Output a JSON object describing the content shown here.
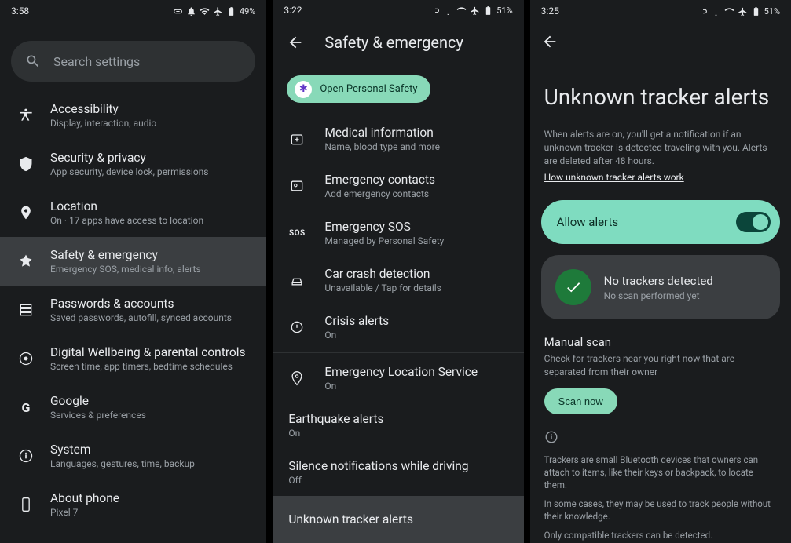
{
  "screen1": {
    "time": "3:58",
    "battery": "49%",
    "search_placeholder": "Search settings",
    "items": [
      {
        "title": "Accessibility",
        "sub": "Display, interaction, audio"
      },
      {
        "title": "Security & privacy",
        "sub": "App security, device lock, permissions"
      },
      {
        "title": "Location",
        "sub": "On · 17 apps have access to location"
      },
      {
        "title": "Safety & emergency",
        "sub": "Emergency SOS, medical info, alerts"
      },
      {
        "title": "Passwords & accounts",
        "sub": "Saved passwords, autofill, synced accounts"
      },
      {
        "title": "Digital Wellbeing & parental controls",
        "sub": "Screen time, app timers, bedtime schedules"
      },
      {
        "title": "Google",
        "sub": "Services & preferences"
      },
      {
        "title": "System",
        "sub": "Languages, gestures, time, backup"
      },
      {
        "title": "About phone",
        "sub": "Pixel 7"
      }
    ]
  },
  "screen2": {
    "time": "3:22",
    "battery": "51%",
    "title": "Safety & emergency",
    "chip": "Open Personal Safety",
    "items": [
      {
        "title": "Medical information",
        "sub": "Name, blood type and more"
      },
      {
        "title": "Emergency contacts",
        "sub": "Add emergency contacts"
      },
      {
        "title": "Emergency SOS",
        "sub": "Managed by Personal Safety"
      },
      {
        "title": "Car crash detection",
        "sub": "Unavailable / Tap for details"
      },
      {
        "title": "Crisis alerts",
        "sub": "On"
      },
      {
        "title": "Emergency Location Service",
        "sub": "On"
      },
      {
        "title": "Earthquake alerts",
        "sub": "On"
      },
      {
        "title": "Silence notifications while driving",
        "sub": "Off"
      },
      {
        "title": "Unknown tracker alerts",
        "sub": ""
      }
    ]
  },
  "screen3": {
    "time": "3:25",
    "battery": "51%",
    "title": "Unknown tracker alerts",
    "desc": "When alerts are on, you'll get a notification if an unknown tracker is detected traveling with you. Alerts are deleted after 48 hours.",
    "link": "How unknown tracker alerts work",
    "toggle_label": "Allow alerts",
    "card_title": "No trackers detected",
    "card_sub": "No scan performed yet",
    "manual_title": "Manual scan",
    "manual_sub": "Check for trackers near you right now that are separated from their owner",
    "scan_btn": "Scan now",
    "p1": "Trackers are small Bluetooth devices that owners can attach to items, like their keys or backpack, to locate them.",
    "p2": "In some cases, they may be used to track people without their knowledge.",
    "p3": "Only compatible trackers can be detected."
  }
}
